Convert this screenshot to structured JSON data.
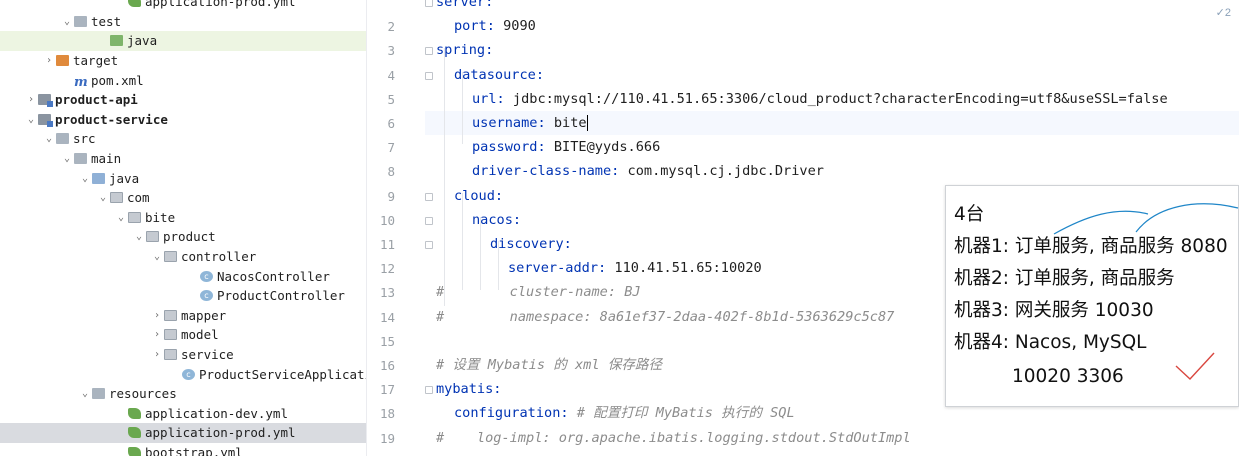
{
  "tree": [
    {
      "label": "application-prod.yml",
      "icon": "yml-file-icon",
      "depth": 6,
      "arrow": ""
    },
    {
      "label": "test",
      "icon": "folder-icon",
      "depth": 3,
      "arrow": "⌄"
    },
    {
      "label": "java",
      "icon": "green-folder-icon",
      "depth": 5,
      "arrow": ""
    },
    {
      "label": "target",
      "icon": "orange-folder-icon",
      "depth": 2,
      "arrow": "›"
    },
    {
      "label": "pom.xml",
      "icon": "maven-icon",
      "depth": 3,
      "arrow": ""
    },
    {
      "label": "product-api",
      "icon": "module-icon",
      "depth": 1,
      "arrow": "›",
      "bold": true
    },
    {
      "label": "product-service",
      "icon": "module-icon",
      "depth": 1,
      "arrow": "⌄",
      "bold": true
    },
    {
      "label": "src",
      "icon": "folder-icon",
      "depth": 2,
      "arrow": "⌄"
    },
    {
      "label": "main",
      "icon": "folder-icon",
      "depth": 3,
      "arrow": "⌄"
    },
    {
      "label": "java",
      "icon": "source-folder-icon",
      "depth": 4,
      "arrow": "⌄"
    },
    {
      "label": "com",
      "icon": "package-icon",
      "depth": 5,
      "arrow": "⌄"
    },
    {
      "label": "bite",
      "icon": "package-icon",
      "depth": 6,
      "arrow": "⌄"
    },
    {
      "label": "product",
      "icon": "package-icon",
      "depth": 7,
      "arrow": "⌄"
    },
    {
      "label": "controller",
      "icon": "package-icon",
      "depth": 8,
      "arrow": "⌄"
    },
    {
      "label": "NacosController",
      "icon": "class-icon",
      "depth": 10,
      "arrow": ""
    },
    {
      "label": "ProductController",
      "icon": "class-icon",
      "depth": 10,
      "arrow": ""
    },
    {
      "label": "mapper",
      "icon": "package-icon",
      "depth": 8,
      "arrow": "›"
    },
    {
      "label": "model",
      "icon": "package-icon",
      "depth": 8,
      "arrow": "›"
    },
    {
      "label": "service",
      "icon": "package-icon",
      "depth": 8,
      "arrow": "›"
    },
    {
      "label": "ProductServiceApplicatio",
      "icon": "class-icon",
      "depth": 9,
      "arrow": ""
    },
    {
      "label": "resources",
      "icon": "resources-folder-icon",
      "depth": 4,
      "arrow": "⌄"
    },
    {
      "label": "application-dev.yml",
      "icon": "yml-file-icon",
      "depth": 6,
      "arrow": ""
    },
    {
      "label": "application-prod.yml",
      "icon": "yml-file-icon",
      "depth": 6,
      "arrow": ""
    },
    {
      "label": "bootstrap.yml",
      "icon": "yml-file-icon",
      "depth": 6,
      "arrow": ""
    }
  ],
  "editor": {
    "warning_count": "2",
    "lines": [
      {
        "n": "",
        "indent": 0,
        "key": "server:",
        "val": "",
        "kind": "kv"
      },
      {
        "n": "2",
        "indent": 1,
        "key": "port:",
        "val": " 9090",
        "kind": "kv"
      },
      {
        "n": "3",
        "indent": 0,
        "key": "spring:",
        "val": "",
        "kind": "kv"
      },
      {
        "n": "4",
        "indent": 1,
        "key": "datasource:",
        "val": "",
        "kind": "kv"
      },
      {
        "n": "5",
        "indent": 2,
        "key": "url:",
        "val": " jdbc:mysql://110.41.51.65:3306/cloud_product?characterEncoding=utf8&useSSL=false",
        "kind": "kv"
      },
      {
        "n": "6",
        "indent": 2,
        "key": "username:",
        "val": " bite",
        "kind": "kv"
      },
      {
        "n": "7",
        "indent": 2,
        "key": "password:",
        "val": " BITE@yyds.666",
        "kind": "kv"
      },
      {
        "n": "8",
        "indent": 2,
        "key": "driver-class-name:",
        "val": " com.mysql.cj.jdbc.Driver",
        "kind": "kv"
      },
      {
        "n": "9",
        "indent": 1,
        "key": "cloud:",
        "val": "",
        "kind": "kv"
      },
      {
        "n": "10",
        "indent": 2,
        "key": "nacos:",
        "val": "",
        "kind": "kv"
      },
      {
        "n": "11",
        "indent": 3,
        "key": "discovery:",
        "val": "",
        "kind": "kv"
      },
      {
        "n": "12",
        "indent": 4,
        "key": "server-addr:",
        "val": " 110.41.51.65:10020",
        "kind": "kv"
      },
      {
        "n": "13",
        "indent": 0,
        "key": "",
        "val": "#        cluster-name: BJ",
        "kind": "comment"
      },
      {
        "n": "14",
        "indent": 0,
        "key": "",
        "val": "#        namespace: 8a61ef37-2daa-402f-8b1d-5363629c5c87",
        "kind": "comment"
      },
      {
        "n": "15",
        "indent": 0,
        "key": "",
        "val": "",
        "kind": "blank"
      },
      {
        "n": "16",
        "indent": 0,
        "key": "",
        "val": "# 设置 Mybatis 的 xml 保存路径",
        "kind": "comment"
      },
      {
        "n": "17",
        "indent": 0,
        "key": "mybatis:",
        "val": "",
        "kind": "kv"
      },
      {
        "n": "18",
        "indent": 1,
        "key": "configuration:",
        "val": " # 配置打印 MyBatis 执行的 SQL",
        "kind": "kvcomment"
      },
      {
        "n": "19",
        "indent": 0,
        "key": "",
        "val": "#    log-impl: org.apache.ibatis.logging.stdout.StdOutImpl",
        "kind": "comment"
      }
    ]
  },
  "note": {
    "lines": [
      "4台",
      "机器1: 订单服务, 商品服务   8080",
      "机器2: 订单服务, 商品服务",
      "机器3: 网关服务    10030",
      "机器4: Nacos, MySQL",
      "10020     3306"
    ]
  },
  "colors": {
    "keyword": "#0033b3",
    "comment": "#8c8c8c",
    "annotation_ink": "#1f86c8",
    "check_ink": "#d9473f"
  }
}
